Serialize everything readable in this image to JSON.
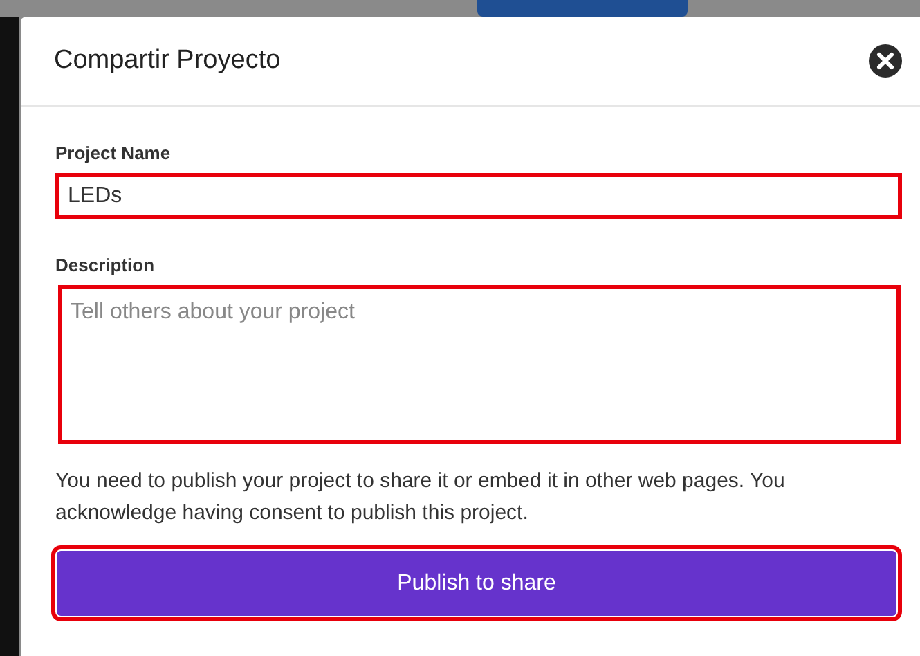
{
  "dialog": {
    "title": "Compartir Proyecto"
  },
  "fields": [
    {
      "kind": "input",
      "label": "Project Name",
      "value": "LEDs"
    },
    {
      "kind": "textarea",
      "label": "Description",
      "placeholder": "Tell others about your project"
    }
  ],
  "notice": "You need to publish your project to share it or embed it in other web pages. You acknowledge having consent to publish this project.",
  "buttons": [
    "Publish to share"
  ]
}
